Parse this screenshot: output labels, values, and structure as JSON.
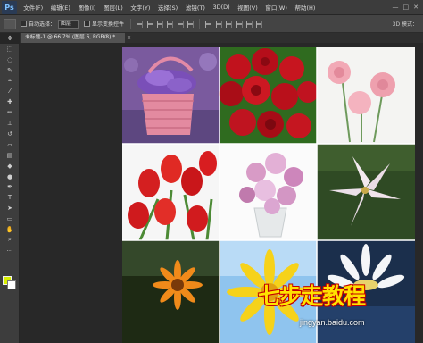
{
  "menubar": {
    "logo": "Ps",
    "items": [
      "文件(F)",
      "编辑(E)",
      "图像(I)",
      "图层(L)",
      "文字(Y)",
      "选择(S)",
      "滤镜(T)",
      "3D(D)",
      "视图(V)",
      "窗口(W)",
      "帮助(H)"
    ],
    "window_buttons": [
      "—",
      "□",
      "✕"
    ]
  },
  "options": {
    "auto_select_label": "自动选择：",
    "auto_select_value": "图层",
    "show_transform_label": "显示变换控件",
    "mode_3d_label": "3D 模式："
  },
  "document": {
    "tab_title": "未标题-1 @ 66.7% (图层 6, RGB/8) *",
    "close_glyph": "×"
  },
  "tools": [
    {
      "icon": "move-icon",
      "glyph": "✥"
    },
    {
      "icon": "marquee-icon",
      "glyph": "⬚"
    },
    {
      "icon": "lasso-icon",
      "glyph": "◌"
    },
    {
      "icon": "quick-select-icon",
      "glyph": "✎"
    },
    {
      "icon": "crop-icon",
      "glyph": "⌗"
    },
    {
      "icon": "eyedropper-icon",
      "glyph": "⁄"
    },
    {
      "icon": "healing-brush-icon",
      "glyph": "✚"
    },
    {
      "icon": "brush-icon",
      "glyph": "✏"
    },
    {
      "icon": "clone-stamp-icon",
      "glyph": "⊥"
    },
    {
      "icon": "history-brush-icon",
      "glyph": "↺"
    },
    {
      "icon": "eraser-icon",
      "glyph": "▱"
    },
    {
      "icon": "gradient-icon",
      "glyph": "▤"
    },
    {
      "icon": "blur-icon",
      "glyph": "◆"
    },
    {
      "icon": "dodge-icon",
      "glyph": "●"
    },
    {
      "icon": "pen-icon",
      "glyph": "✒"
    },
    {
      "icon": "type-icon",
      "glyph": "T"
    },
    {
      "icon": "path-select-icon",
      "glyph": "➤"
    },
    {
      "icon": "shape-icon",
      "glyph": "▭"
    },
    {
      "icon": "hand-icon",
      "glyph": "✋"
    },
    {
      "icon": "zoom-icon",
      "glyph": "⌕"
    },
    {
      "icon": "more-icon",
      "glyph": "···"
    }
  ],
  "colors": {
    "foreground": "#d9f000",
    "background": "#ffffff"
  },
  "watermark": {
    "main": "七步走教程",
    "sub": "jingyan.baidu.com"
  }
}
